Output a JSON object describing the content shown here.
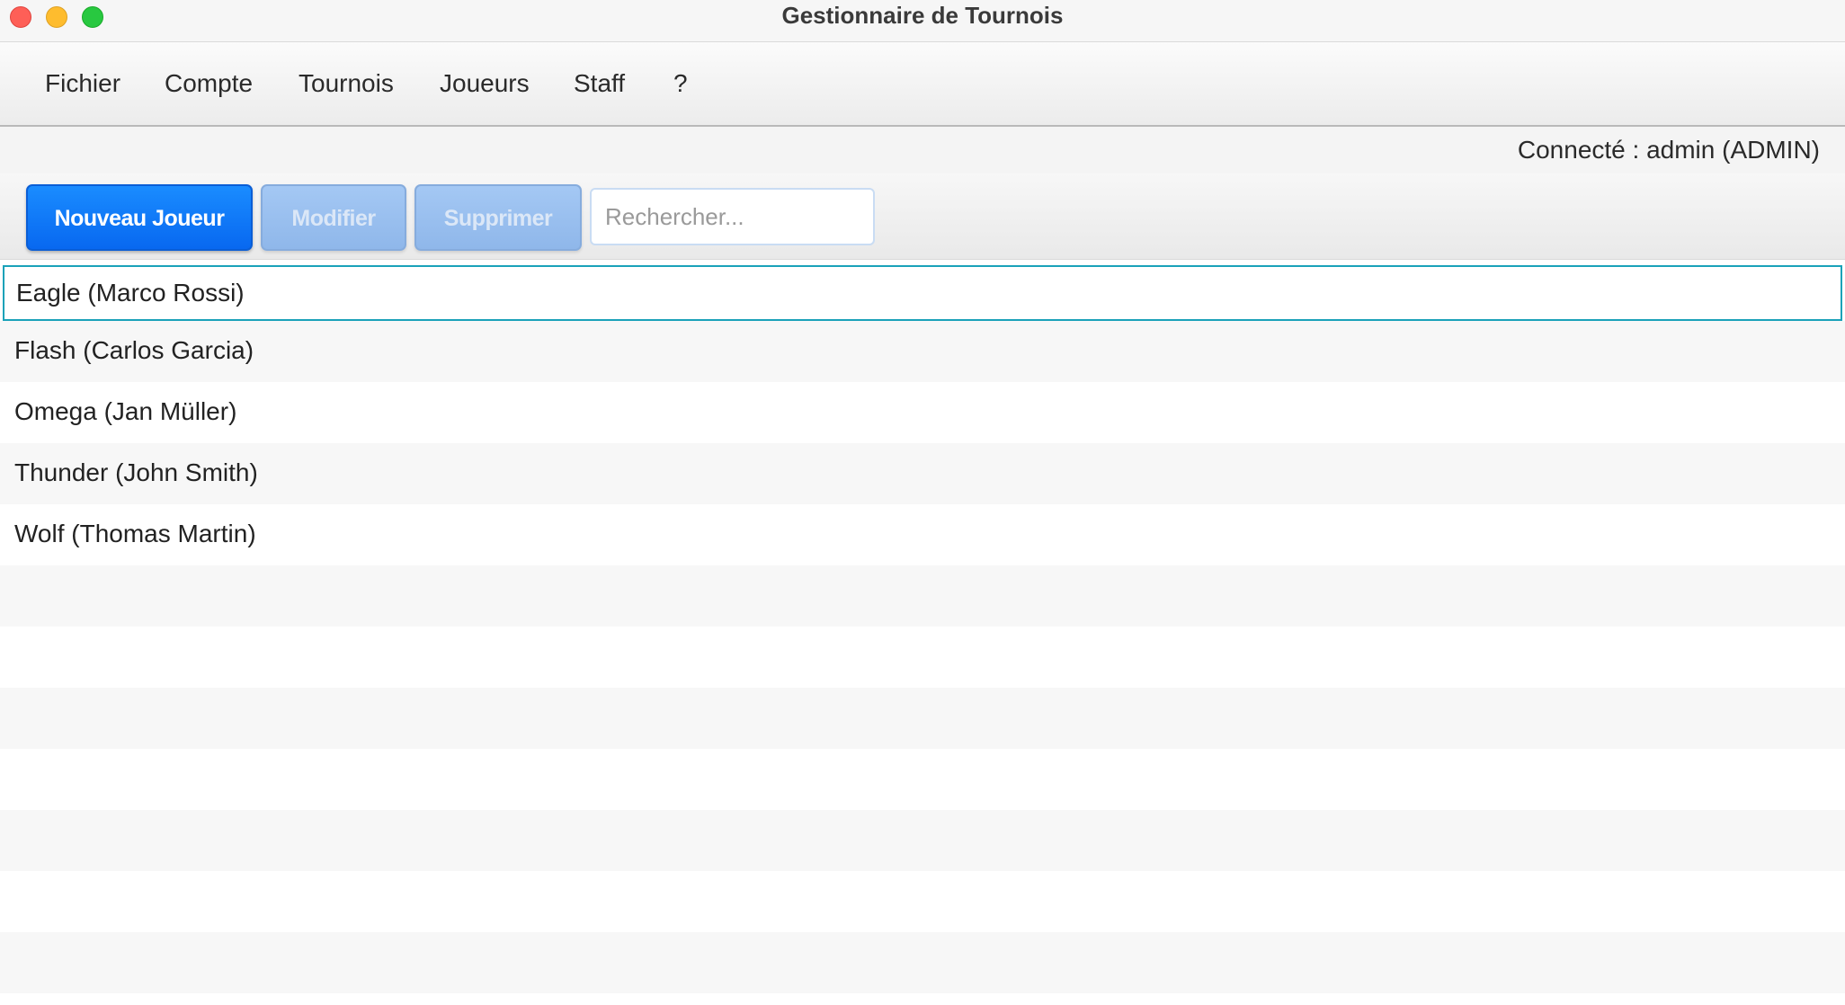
{
  "window": {
    "title": "Gestionnaire de Tournois"
  },
  "menu": {
    "items": [
      {
        "label": "Fichier"
      },
      {
        "label": "Compte"
      },
      {
        "label": "Tournois"
      },
      {
        "label": "Joueurs"
      },
      {
        "label": "Staff"
      },
      {
        "label": "?"
      }
    ]
  },
  "status": {
    "connected": "Connecté : admin (ADMIN)"
  },
  "toolbar": {
    "new_label": "Nouveau Joueur",
    "modify_label": "Modifier",
    "delete_label": "Supprimer",
    "search_placeholder": "Rechercher...",
    "search_value": ""
  },
  "players": [
    {
      "label": "Eagle (Marco Rossi)",
      "selected": true
    },
    {
      "label": "Flash (Carlos Garcia)",
      "selected": false
    },
    {
      "label": "Omega (Jan Müller)",
      "selected": false
    },
    {
      "label": "Thunder (John Smith)",
      "selected": false
    },
    {
      "label": "Wolf (Thomas Martin)",
      "selected": false
    }
  ],
  "colors": {
    "accent": "#0a6cf2",
    "selection_border": "#1aa2b9",
    "disabled_button": "#9bbfee"
  }
}
